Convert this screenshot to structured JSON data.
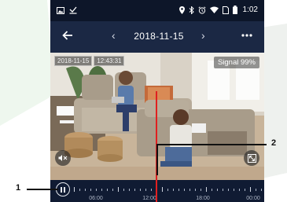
{
  "status_bar": {
    "left_icons": [
      "image-icon",
      "download-icon"
    ],
    "right_icons": [
      "location-icon",
      "bluetooth-icon",
      "alarm-icon",
      "wifi-icon",
      "sim-icon",
      "battery-icon"
    ],
    "time": "1:02"
  },
  "nav": {
    "back_icon": "back-arrow-icon",
    "prev_label": "‹",
    "date": "2018-11-15",
    "next_label": "›",
    "more_icon": "more-dots-icon"
  },
  "video": {
    "timestamp_date": "2018-11-15",
    "timestamp_time": "12:43:31",
    "signal": "Signal 99%",
    "mute_icon": "speaker-mute-icon",
    "expand_icon": "collapse-fullscreen-icon"
  },
  "timeline": {
    "pause_icon": "pause-icon",
    "labels": [
      "06:00",
      "12:00",
      "18:00",
      "00:00"
    ]
  },
  "callouts": {
    "one": "1",
    "two": "2"
  }
}
